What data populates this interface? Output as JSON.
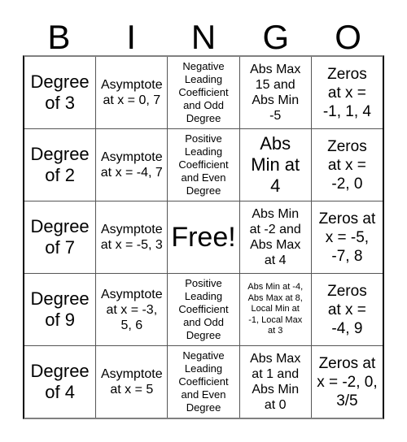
{
  "card": {
    "title": "BINGO",
    "headers": [
      "B",
      "I",
      "N",
      "G",
      "O"
    ],
    "free_label": "Free!",
    "rows": [
      {
        "cells": [
          {
            "text": "Degree\nof 3",
            "size": "xl"
          },
          {
            "text": "Asymptote\nat x = 0, 7",
            "size": "md"
          },
          {
            "text": "Negative\nLeading\nCoefficient\nand Odd\nDegree",
            "size": "sm"
          },
          {
            "text": "Abs Max\n15 and\nAbs Min\n-5",
            "size": "md"
          },
          {
            "text": "Zeros\nat x =\n-1, 1, 4",
            "size": "lg"
          }
        ]
      },
      {
        "cells": [
          {
            "text": "Degree\nof 2",
            "size": "xl"
          },
          {
            "text": "Asymptote\nat x = -4, 7",
            "size": "md"
          },
          {
            "text": "Positive\nLeading\nCoefficient\nand Even\nDegree",
            "size": "sm"
          },
          {
            "text": "Abs\nMin at\n4",
            "size": "xl"
          },
          {
            "text": "Zeros\nat x =\n-2, 0",
            "size": "lg"
          }
        ]
      },
      {
        "cells": [
          {
            "text": "Degree\nof 7",
            "size": "xl"
          },
          {
            "text": "Asymptote\nat x = -5, 3",
            "size": "md"
          },
          {
            "text": "Free!",
            "size": "free"
          },
          {
            "text": "Abs Min\nat -2 and\nAbs Max\nat 4",
            "size": "md"
          },
          {
            "text": "Zeros at\nx = -5,\n-7, 8",
            "size": "lg"
          }
        ]
      },
      {
        "cells": [
          {
            "text": "Degree\nof 9",
            "size": "xl"
          },
          {
            "text": "Asymptote\nat x = -3,\n5, 6",
            "size": "md"
          },
          {
            "text": "Positive\nLeading\nCoefficient\nand Odd\nDegree",
            "size": "sm"
          },
          {
            "text": "Abs Min at -4,\nAbs Max at 8,\nLocal Min at\n-1, Local Max\nat 3",
            "size": "xs"
          },
          {
            "text": "Zeros\nat x =\n-4, 9",
            "size": "lg"
          }
        ]
      },
      {
        "cells": [
          {
            "text": "Degree\nof 4",
            "size": "xl"
          },
          {
            "text": "Asymptote\nat x = 5",
            "size": "md"
          },
          {
            "text": "Negative\nLeading\nCoefficient\nand Even\nDegree",
            "size": "sm"
          },
          {
            "text": "Abs Max\nat 1 and\nAbs Min\nat 0",
            "size": "md"
          },
          {
            "text": "Zeros at\nx = -2, 0,\n3/5",
            "size": "lg"
          }
        ]
      }
    ]
  },
  "colors": {
    "background": "#ffffff",
    "text": "#000000",
    "grid_line": "#555555",
    "grid_border": "#000000"
  }
}
